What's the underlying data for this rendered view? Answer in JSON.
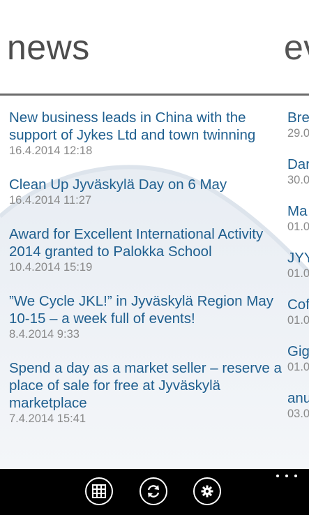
{
  "pivot": {
    "news_header": "news",
    "events_header": "ev"
  },
  "news": [
    {
      "title": "New business leads in China with the support of Jykes Ltd and town twinning",
      "date": "16.4.2014 12:18"
    },
    {
      "title": "Clean Up Jyväskylä Day on 6 May",
      "date": "16.4.2014 11:27"
    },
    {
      "title": "Award for Excellent International Activity 2014 granted to Palokka School",
      "date": "10.4.2014 15:19"
    },
    {
      "title": "”We Cycle JKL!” in Jyväskylä Region May 10-15 – a week full of events!",
      "date": "8.4.2014 9:33"
    },
    {
      "title": "Spend a day as a market seller – reserve a place of sale for free at Jyväskylä marketplace",
      "date": "7.4.2014 15:41"
    }
  ],
  "events": [
    {
      "title": "Bre",
      "date": "29.0"
    },
    {
      "title": "Dar",
      "date": "30.0"
    },
    {
      "title": "Ma",
      "date": "01.0"
    },
    {
      "title": "JYY",
      "date": "01.0"
    },
    {
      "title": "Cof",
      "date": "01.0"
    },
    {
      "title": "Gig",
      "date": "01.0"
    },
    {
      "title": "anu",
      "date": "03.0"
    }
  ],
  "appbar": {
    "buttons": [
      "tiles-icon",
      "refresh-icon",
      "settings-icon"
    ],
    "more_icon": "ellipsis-icon"
  },
  "colors": {
    "accent_title": "#1f5f8f",
    "date_gray": "#8a8a8a",
    "header_gray": "#4d4d4d",
    "appbar": "#000000"
  }
}
